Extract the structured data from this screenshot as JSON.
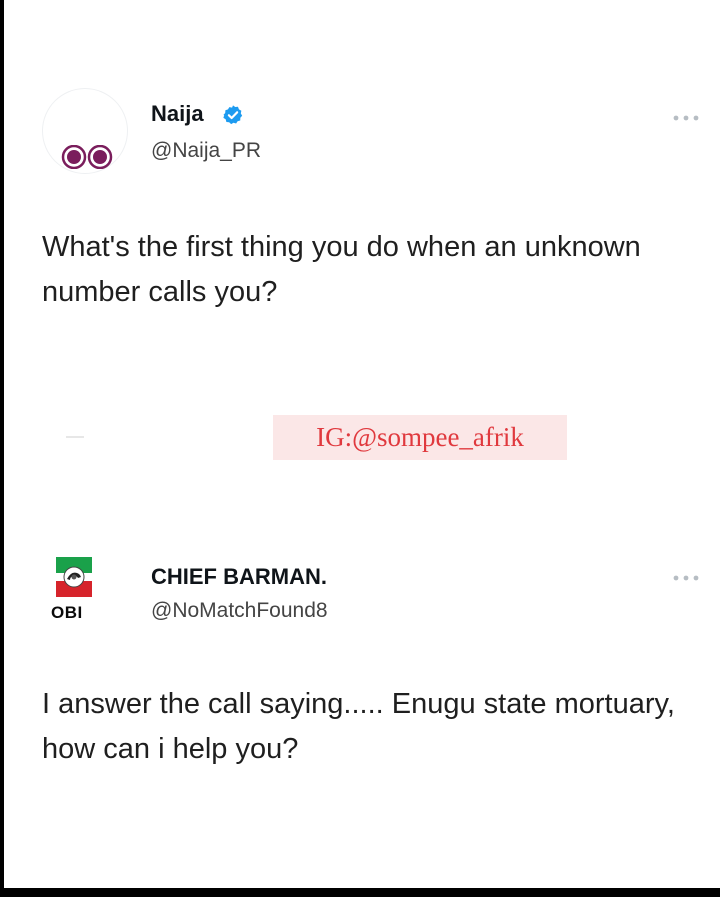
{
  "tweet1": {
    "name": "Naija",
    "handle": "@Naija_PR",
    "text": "What's the first thing you do when an unknown number calls you?",
    "avatar_icon": "eyes-icon",
    "accent": "#1d9bf0"
  },
  "watermark": {
    "text": "IG:@sompee_afrik",
    "color": "#e0393e"
  },
  "tweet2": {
    "name": "CHIEF BARMAN.",
    "handle": "@NoMatchFound8",
    "text": "I answer the call saying..... Enugu state mortuary, how can i help you?",
    "avatar_label": "OBI",
    "avatar_icon": "party-logo-icon"
  }
}
